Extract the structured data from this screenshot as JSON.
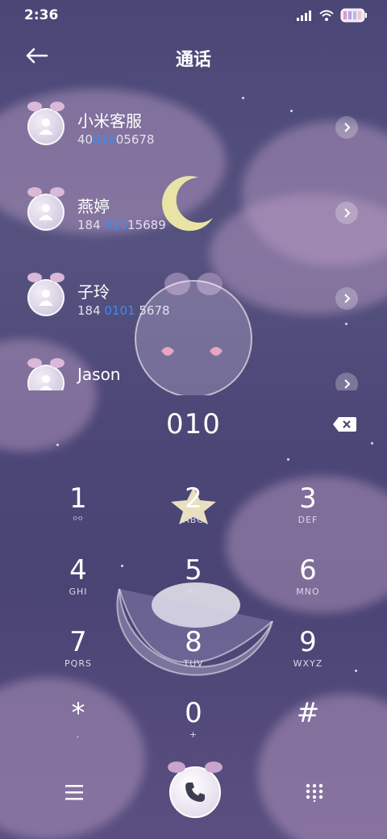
{
  "status": {
    "time": "2:36"
  },
  "header": {
    "title": "通话"
  },
  "contacts": [
    {
      "name": "小米客服",
      "num_pre": "40",
      "num_hl": "010",
      "num_post": "05678"
    },
    {
      "name": "燕婷",
      "num_pre": "184 ",
      "num_hl": "010",
      "num_post": "15689"
    },
    {
      "name": "子玲",
      "num_pre": "184 ",
      "num_hl": "0101",
      "num_post": " 5678"
    },
    {
      "name": "Jason",
      "num_pre": "",
      "num_hl": "",
      "num_post": ""
    }
  ],
  "dialer": {
    "input": "010",
    "keys": [
      {
        "digit": "1",
        "letters": "ᴼᴼ"
      },
      {
        "digit": "2",
        "letters": "ABC"
      },
      {
        "digit": "3",
        "letters": "DEF"
      },
      {
        "digit": "4",
        "letters": "GHI"
      },
      {
        "digit": "5",
        "letters": "JKL"
      },
      {
        "digit": "6",
        "letters": "MNO"
      },
      {
        "digit": "7",
        "letters": "PQRS"
      },
      {
        "digit": "8",
        "letters": "TUV"
      },
      {
        "digit": "9",
        "letters": "WXYZ"
      },
      {
        "digit": "*",
        "letters": ","
      },
      {
        "digit": "0",
        "letters": "+"
      },
      {
        "digit": "#",
        "letters": ""
      }
    ]
  },
  "colors": {
    "highlight": "#3c8cf0"
  }
}
